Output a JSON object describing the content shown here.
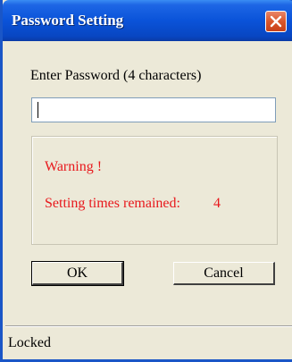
{
  "window": {
    "title": "Password Setting",
    "close_icon": "close-icon"
  },
  "form": {
    "password_label": "Enter Password (4 characters)",
    "password_value": "",
    "password_placeholder": ""
  },
  "warning": {
    "title": "Warning !",
    "times_label": "Setting times remained:",
    "times_count": "4",
    "color": "#e8181c"
  },
  "buttons": {
    "ok_label": "OK",
    "cancel_label": "Cancel"
  },
  "status": {
    "text": "Locked"
  },
  "colors": {
    "titlebar": "#0a53d9",
    "close_button": "#d9572c",
    "dialog_background": "#ece9d8"
  }
}
